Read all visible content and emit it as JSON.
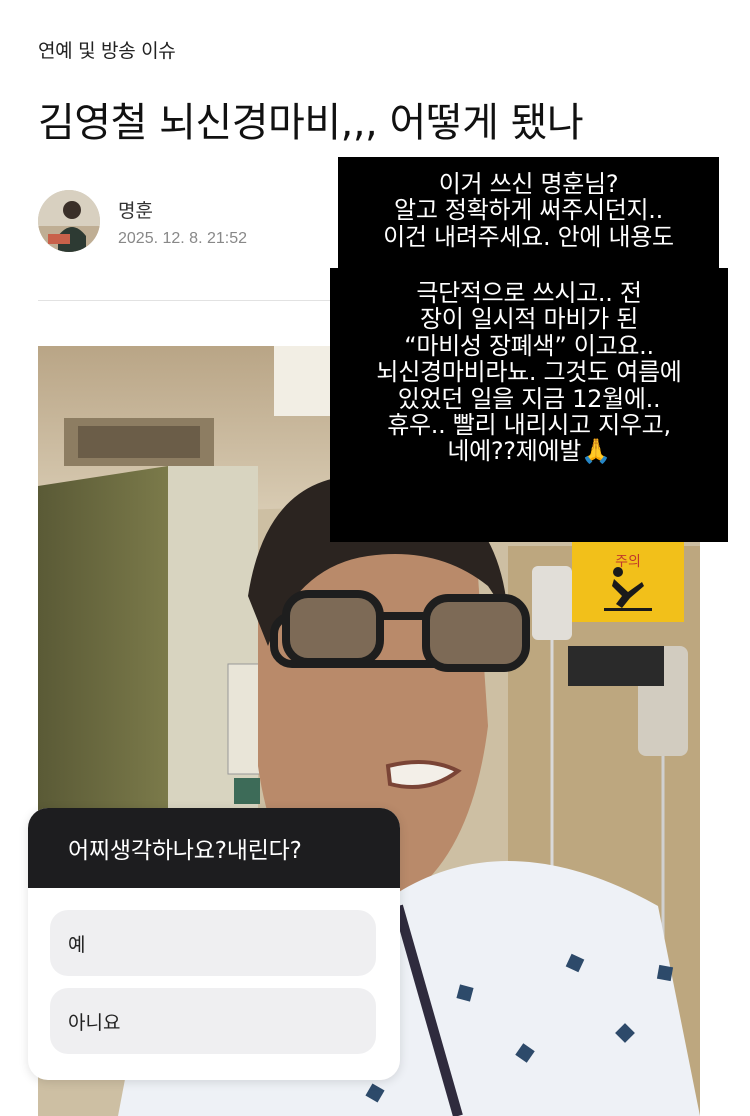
{
  "article": {
    "category": "연예 및 방송 이슈",
    "title": "김영철 뇌신경마비,,, 어떻게 됐나",
    "author": "명훈",
    "date": "2025. 12. 8. 21:52"
  },
  "photo": {
    "sign_text": "주의"
  },
  "story": {
    "text_a": "이거 쓰신 명훈님?\n알고 정확하게 써주시던지..\n이건 내려주세요. 안에 내용도",
    "text_b": "극단적으로 쓰시고.. 전\n장이 일시적 마비가 된\n“마비성 장폐색” 이고요..\n뇌신경마비라뇨. 그것도 여름에\n있었던 일을 지금 12월에..\n휴우.. 빨리 내리시고 지우고,\n네에??제에발🙏"
  },
  "poll": {
    "question": "어찌생각하나요?내린다?",
    "options": [
      "예",
      "아니요"
    ]
  }
}
